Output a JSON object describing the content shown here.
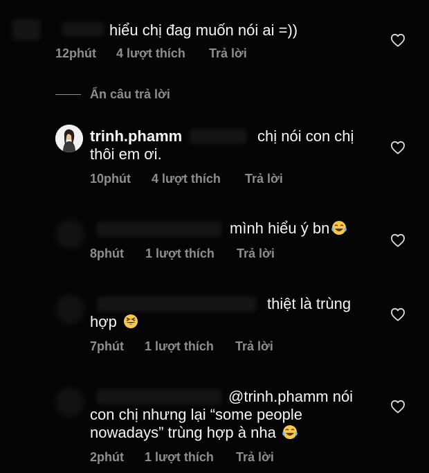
{
  "comments": [
    {
      "text": "hiểu chị đag muốn nói ai =))",
      "time": "12phút",
      "likes": "4 lượt thích",
      "reply": "Trả lời"
    },
    {
      "username": "trinh.phamm",
      "line1": "chị nói con chị",
      "line2": "thôi em ơi.",
      "time": "10phút",
      "likes": "4 lượt thích",
      "reply": "Trả lời"
    },
    {
      "text": "mình hiểu ý bn",
      "emoji": "tears-of-joy-emoji",
      "time": "8phút",
      "likes": "1 lượt thích",
      "reply": "Trả lời"
    },
    {
      "line1": "thiệt là trùng",
      "line2": "hợp",
      "emoji": "grinning-squint-emoji",
      "time": "7phút",
      "likes": "1 lượt thích",
      "reply": "Trả lời"
    },
    {
      "line1": "@trinh.phamm nói",
      "line2": "con chị nhưng lại “some people",
      "line3": "nowadays” trùng hợp à nha",
      "emoji": "tears-of-joy-emoji",
      "time": "2phút",
      "likes": "1 lượt thích",
      "reply": "Trả lời"
    }
  ],
  "hide_replies": "Ẩn câu trả lời",
  "colors": {
    "background": "#050505",
    "meta": "#8e8e8e",
    "text": "#f5f5f5"
  },
  "icons": {
    "like": "heart-icon"
  }
}
